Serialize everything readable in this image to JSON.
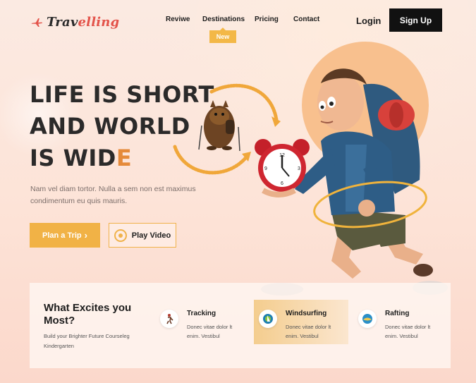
{
  "brand": {
    "name_first": "Trav",
    "name_second": "elling"
  },
  "nav": {
    "items": [
      {
        "label": "Reviwe"
      },
      {
        "label": "Destinations"
      },
      {
        "label": "Pricing"
      },
      {
        "label": "Contact"
      }
    ],
    "badge": "New",
    "login": "Login",
    "signup": "Sign Up"
  },
  "hero": {
    "title_line1": "LIFE IS SHORT",
    "title_line2": "AND WORLD",
    "title_line3_a": "IS WID",
    "title_line3_b": "E",
    "description": "Nam vel diam tortor. Nulla a sem non est maximus condimentum eu quis mauris.",
    "plan_button": "Plan a Trip",
    "plan_arrow": "›",
    "play_button": "Play Video"
  },
  "excites": {
    "title": "What Excites you Most?",
    "subtitle": "Build your Brighter Future Courseleg Kindergarten",
    "features": [
      {
        "title": "Tracking",
        "desc": "Donec vitae dolor lt enim. Vestibul",
        "icon": "hiker-icon"
      },
      {
        "title": "Windsurfing",
        "desc": "Donec vitae dolor lt enim. Vestibul",
        "icon": "windsurf-icon"
      },
      {
        "title": "Rafting",
        "desc": "Donec vitae dolor lt enim. Vestibul",
        "icon": "raft-icon"
      }
    ]
  },
  "colors": {
    "accent": "#f1b246",
    "brand_red": "#e3534a",
    "dark": "#111111",
    "text": "#2b2a2a"
  }
}
